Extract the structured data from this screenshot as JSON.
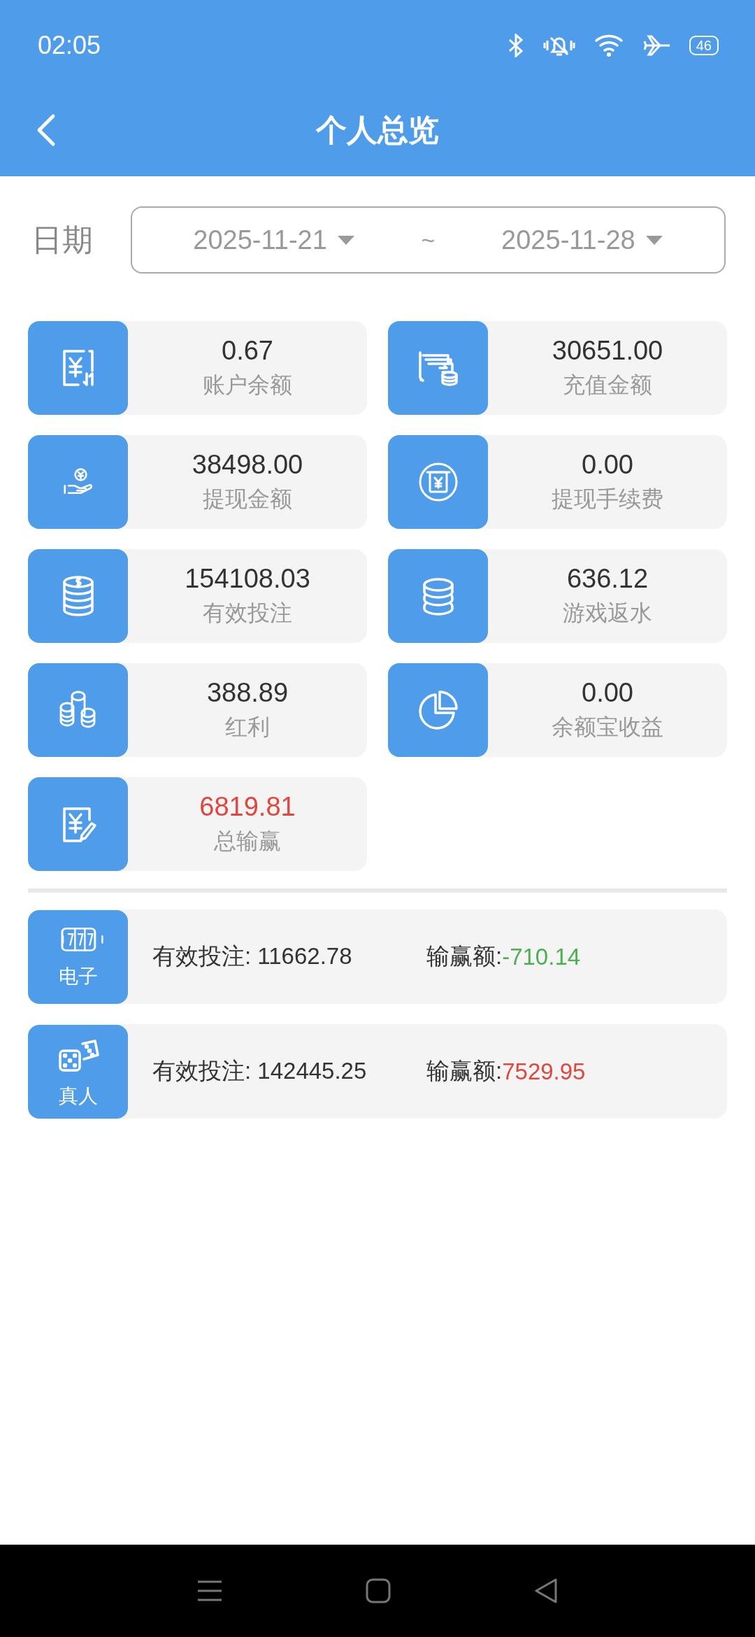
{
  "status_bar": {
    "time": "02:05",
    "battery": "46"
  },
  "header": {
    "title": "个人总览"
  },
  "date_filter": {
    "label": "日期",
    "start": "2025-11-21",
    "separator": "~",
    "end": "2025-11-28"
  },
  "stats": [
    {
      "value": "0.67",
      "label": "账户余额",
      "color": "#333333"
    },
    {
      "value": "30651.00",
      "label": "充值金额",
      "color": "#333333"
    },
    {
      "value": "38498.00",
      "label": "提现金额",
      "color": "#333333"
    },
    {
      "value": "0.00",
      "label": "提现手续费",
      "color": "#333333"
    },
    {
      "value": "154108.03",
      "label": "有效投注",
      "color": "#333333"
    },
    {
      "value": "636.12",
      "label": "游戏返水",
      "color": "#333333"
    },
    {
      "value": "388.89",
      "label": "红利",
      "color": "#333333"
    },
    {
      "value": "0.00",
      "label": "余额宝收益",
      "color": "#333333"
    },
    {
      "value": "6819.81",
      "label": "总输赢",
      "color": "#e0473f"
    }
  ],
  "games": [
    {
      "name": "电子",
      "bet_label": "有效投注: 11662.78",
      "win_label": "输赢额:",
      "win_value": "-710.14",
      "color": "#4caf50"
    },
    {
      "name": "真人",
      "bet_label": "有效投注: 142445.25",
      "win_label": "输赢额:",
      "win_value": "7529.95",
      "color": "#e0473f"
    }
  ]
}
